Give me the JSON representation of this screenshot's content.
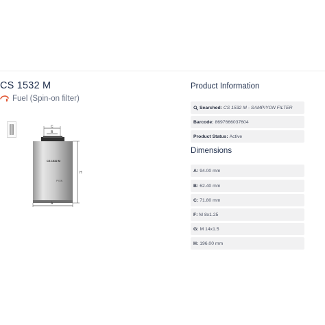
{
  "product": {
    "code": "CS 1532 M",
    "category": "Fuel (Spin-on filter)"
  },
  "diagram": {
    "dimension_letters": {
      "c": "C",
      "b": "B",
      "h": "H",
      "a": "A"
    },
    "filter_label": "CS 1532 M",
    "brand_mark": "PYON"
  },
  "info": {
    "heading": "Product Information",
    "searched": {
      "label": "Searched:",
      "value": "CS 1532 M - SAMPIYON FILTER"
    },
    "barcode": {
      "label": "Barcode:",
      "value": "8697666037604"
    },
    "status": {
      "label": "Product Status:",
      "value": "Active"
    }
  },
  "dimensions": {
    "heading": "Dimensions",
    "rows": [
      {
        "label": "A:",
        "value": "94.00 mm"
      },
      {
        "label": "B:",
        "value": "62.40 mm"
      },
      {
        "label": "C:",
        "value": "71.80 mm"
      },
      {
        "label": "F:",
        "value": "M 8x1.25"
      },
      {
        "label": "G:",
        "value": "M 14x1.5"
      },
      {
        "label": "H:",
        "value": "196.00 mm"
      }
    ]
  },
  "colors": {
    "heading": "#23324f",
    "row_background": "#f1f1f2",
    "accent_icon": "#e0522e"
  }
}
